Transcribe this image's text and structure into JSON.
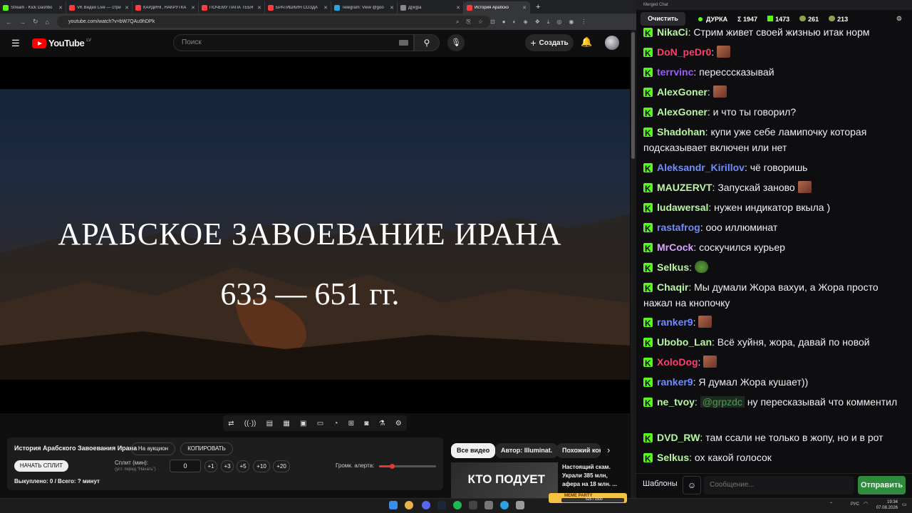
{
  "browser": {
    "tabs": [
      {
        "label": "Stream - Kick Dashbo",
        "color": "#53fc18"
      },
      {
        "label": "VK Видео Live — стри",
        "color": "#ff3b3b"
      },
      {
        "label": "КАРДИНГ, НАКРУТКА",
        "color": "#ff3b3b"
      },
      {
        "label": "ПОЧЕМУ ПАПА ТЕБЯ",
        "color": "#ff3b3b"
      },
      {
        "label": "БРАТИШКИН СОЗДА",
        "color": "#ff3b3b"
      },
      {
        "label": "Telegram: View @goo",
        "color": "#2aa3df"
      },
      {
        "label": "Д[w]ра",
        "color": "#888888"
      },
      {
        "label": "История Арабско",
        "color": "#ff3b3b"
      }
    ],
    "new_tab": "+",
    "window_controls": {
      "minimize": "–",
      "maximize": "□",
      "close": "✕",
      "tabs_menu": "⌄"
    },
    "url": "youtube.com/watch?v=bW7QAu9hDPk"
  },
  "youtube": {
    "logo_text": "YouTube",
    "country": "LV",
    "search_placeholder": "Поиск",
    "create_label": "Создать",
    "video": {
      "title_line1": "АРАБСКОЕ ЗАВОЕВАНИЕ ИРАНА",
      "title_line2": "633 — 651 гг."
    }
  },
  "auction": {
    "title": "История Арабского Завоевания Ирана",
    "to_auction": "На аукцион",
    "copy": "КОПИРОВАТЬ",
    "start_split": "НАЧАТЬ СПЛИТ",
    "split_label": "Сплит (мин):",
    "split_hint": "(уст. перед \"Начать\")",
    "split_value": "0",
    "increments": [
      "+1",
      "+3",
      "+5",
      "+10",
      "+20"
    ],
    "volume_label": "Громк. алерта:",
    "volume_level": 0.22,
    "bought": "Выкуплено: 0 / Всего: ? минут"
  },
  "recommendations": {
    "chips": [
      "Все видео",
      "Автор: Illuminat.",
      "Похожий кон"
    ],
    "thumb_title": "Настоящий скам. Украли 385 млн, афера на 18 млн. ...",
    "thumb_overlay": "КТО ПОДУЕТ"
  },
  "chat": {
    "window_title": "Merged Chat",
    "clear": "Очистить",
    "stats": [
      {
        "label": "ДУРКА",
        "icon": "dot"
      },
      {
        "label": "Σ 1947",
        "icon": ""
      },
      {
        "label": "1473",
        "icon": "kick"
      },
      {
        "label": "261",
        "icon": "frog"
      },
      {
        "label": "213",
        "icon": "frog"
      }
    ],
    "messages": [
      {
        "user": "NikaCi",
        "color": "#b8f7a0",
        "text": "Стрим живет своей жизнью итак норм"
      },
      {
        "user": "DoN_peDr0",
        "color": "#ff3d6e",
        "text": "",
        "emote": true
      },
      {
        "user": "terrvinc",
        "color": "#9b59ff",
        "text": "пересссказывай"
      },
      {
        "user": "AlexGoner",
        "color": "#b8f7a0",
        "text": "",
        "emote": true
      },
      {
        "user": "AlexGoner",
        "color": "#b8f7a0",
        "text": "и что ты говорил?"
      },
      {
        "user": "Shadohan",
        "color": "#b8f7a0",
        "text": "купи уже себе ламипочку которая подсказывает включен или нет"
      },
      {
        "user": "Aleksandr_Kirillov",
        "color": "#6f8cff",
        "text": "чё говоришь"
      },
      {
        "user": "MAUZERVT",
        "color": "#b8f7a0",
        "text": "Запускай заново",
        "emote": true
      },
      {
        "user": "ludawersal",
        "color": "#b8f7a0",
        "text": "нужен индикатор вкыла )"
      },
      {
        "user": "rastafrog",
        "color": "#6f8cff",
        "text": "ооо иллюминат"
      },
      {
        "user": "MrCock",
        "color": "#d9a6ff",
        "text": "соскучился курьер"
      },
      {
        "user": "Selkus",
        "color": "#b8f7a0",
        "text": "",
        "frog": true
      },
      {
        "user": "Chaqir",
        "color": "#b8f7a0",
        "text": "Мы думали Жора вахуи, а Жора просто нажал на кнопочку"
      },
      {
        "user": "ranker9",
        "color": "#6f8cff",
        "text": "",
        "emote": true
      },
      {
        "user": "Ubobo_Lan",
        "color": "#b8f7a0",
        "text": "Всё хуйня, жора, давай по новой"
      },
      {
        "user": "XoloDog",
        "color": "#ff3d6e",
        "text": "",
        "emote": true
      },
      {
        "user": "ranker9",
        "color": "#6f8cff",
        "text": "Я думал Жора кушает))"
      },
      {
        "user": "ne_tvoy",
        "color": "#b8f7a0",
        "mention": "@grpzdc",
        "text": "ну пересказывай что комментил"
      },
      {
        "user": "DVD_RW",
        "color": "#b8f7a0",
        "text": "там ссали не только в жопу, но и в рот"
      },
      {
        "user": "Selkus",
        "color": "#b8f7a0",
        "text": "ох какой голосок"
      }
    ],
    "templates": "Шаблоны",
    "input_placeholder": "Сообщение...",
    "send": "Отправить"
  },
  "taskbar": {
    "lang": "РУС",
    "time": "19:34",
    "date": "07.08.2026",
    "meme_party": "MEME PARTY",
    "meme_counter": "625 / 1500"
  }
}
